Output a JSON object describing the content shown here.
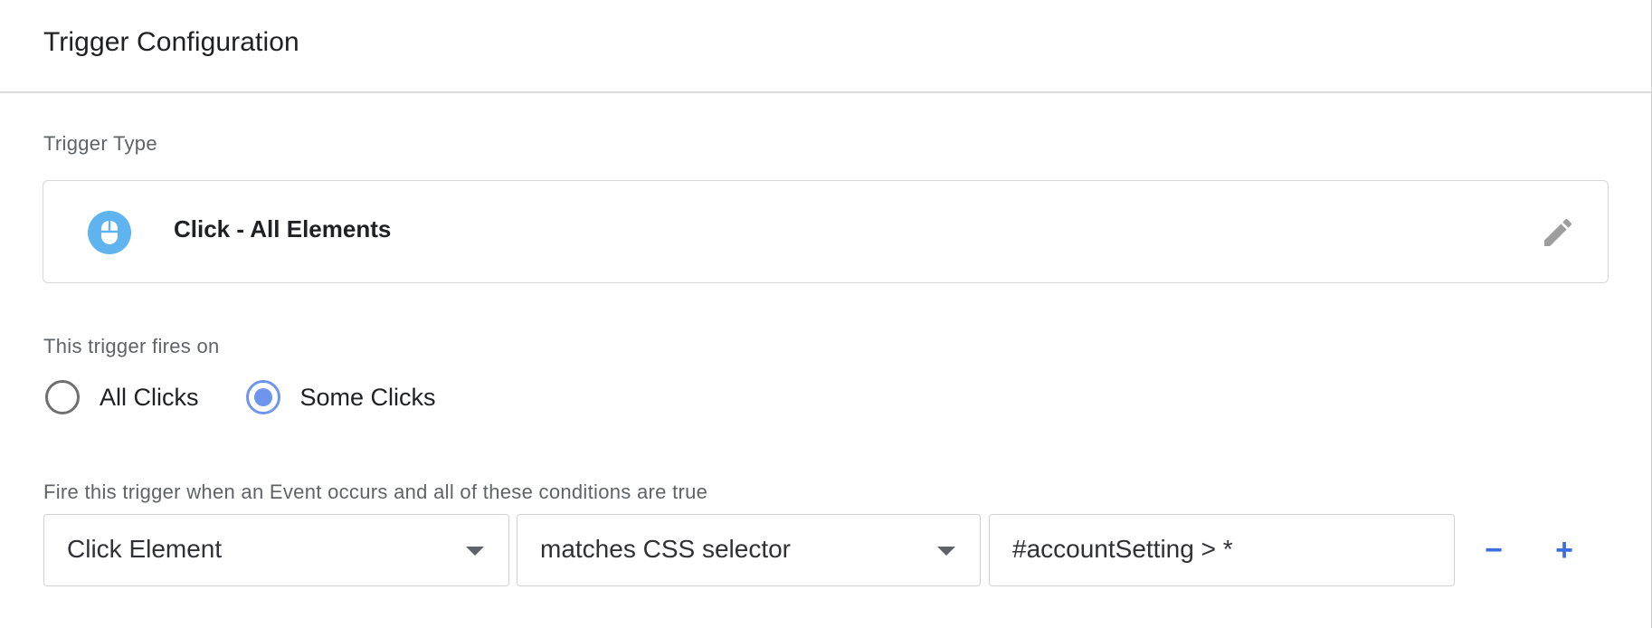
{
  "header": {
    "title": "Trigger Configuration"
  },
  "trigger_type": {
    "section_label": "Trigger Type",
    "name": "Click - All Elements",
    "icon": "mouse-icon",
    "icon_color": "#5fb4ef",
    "edit_icon": "pencil-icon"
  },
  "fires_on": {
    "section_label": "This trigger fires on",
    "options": [
      {
        "label": "All Clicks",
        "checked": false
      },
      {
        "label": "Some Clicks",
        "checked": true
      }
    ],
    "accent_color": "#6e95ee"
  },
  "conditions": {
    "section_label": "Fire this trigger when an Event occurs and all of these conditions are true",
    "variable": "Click Element",
    "operator": "matches CSS selector",
    "value": "#accountSetting > *",
    "remove_label": "−",
    "add_label": "+"
  }
}
